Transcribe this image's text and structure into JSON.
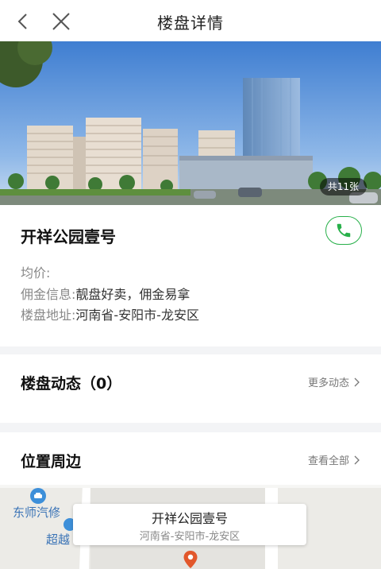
{
  "header": {
    "title": "楼盘详情"
  },
  "hero": {
    "photo_count": "共11张"
  },
  "property": {
    "name": "开祥公园壹号",
    "price_label": "均价:",
    "price_value": "",
    "commission_label": "佣金信息:",
    "commission_value": "靓盘好卖，佣金易拿",
    "address_label": "楼盘地址:",
    "address_value": "河南省-安阳市-龙安区"
  },
  "dynamics": {
    "title": "楼盘动态（0）",
    "more_label": "更多动态"
  },
  "location": {
    "title": "位置周边",
    "more_label": "查看全部",
    "map_card_name": "开祥公园壹号",
    "map_card_address": "河南省-安阳市-龙安区",
    "poi_1": "东师汽修",
    "poi_2": "超越"
  },
  "colors": {
    "phone_green": "#28b04a",
    "pin_orange": "#e2572b"
  }
}
